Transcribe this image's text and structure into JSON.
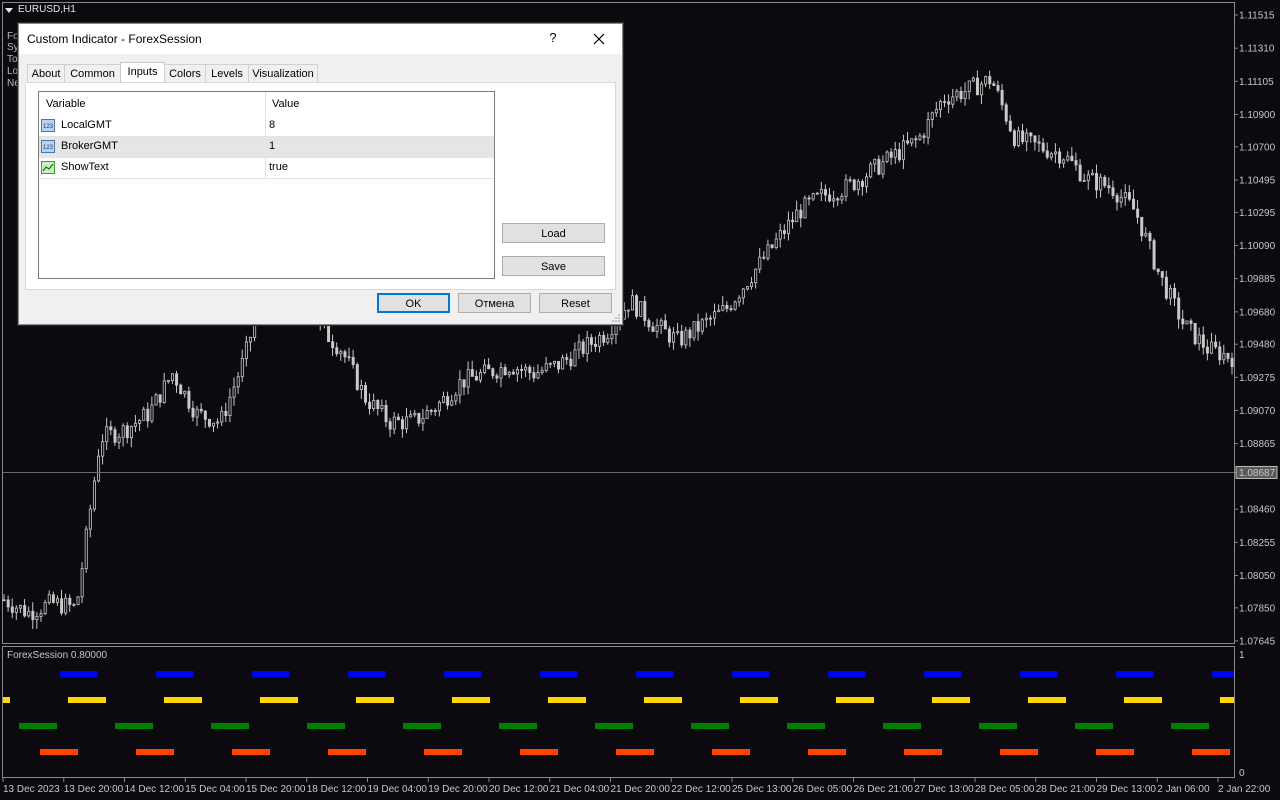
{
  "window": {
    "symbol_title": "EURUSD,H1"
  },
  "left_stubs": [
    "Fo",
    "Sy",
    "To",
    "Lo",
    "Ne"
  ],
  "price_axis": {
    "labels": [
      "1.11515",
      "1.11310",
      "1.11105",
      "1.10900",
      "1.10700",
      "1.10495",
      "1.10295",
      "1.10090",
      "1.09885",
      "1.09680",
      "1.09480",
      "1.09275",
      "1.09070",
      "1.08865",
      "1.08687",
      "1.08460",
      "1.08255",
      "1.08050",
      "1.07850",
      "1.07645"
    ],
    "current_price": "1.08687"
  },
  "time_axis": {
    "labels": [
      "13 Dec 2023",
      "13 Dec 20:00",
      "14 Dec 12:00",
      "15 Dec 04:00",
      "15 Dec 20:00",
      "18 Dec 12:00",
      "19 Dec 04:00",
      "19 Dec 20:00",
      "20 Dec 12:00",
      "21 Dec 04:00",
      "21 Dec 20:00",
      "22 Dec 12:00",
      "25 Dec 13:00",
      "26 Dec 05:00",
      "26 Dec 21:00",
      "27 Dec 13:00",
      "28 Dec 05:00",
      "28 Dec 21:00",
      "29 Dec 13:00",
      "2 Jan 06:00",
      "2 Jan 22:00"
    ]
  },
  "subwindow": {
    "title": "ForexSession 0.80000",
    "scale_top": "1",
    "scale_bottom": "0",
    "session_colors": [
      "#0000ff",
      "#ffd700",
      "#008000",
      "#ff4500"
    ]
  },
  "chart_data": {
    "type": "candlestick",
    "approx_close_path": [
      1.079,
      1.0782,
      1.0788,
      1.0785,
      1.089,
      1.0895,
      1.0905,
      1.093,
      1.0905,
      1.09,
      1.094,
      1.0995,
      1.101,
      1.096,
      1.0945,
      1.0915,
      1.09,
      1.09,
      1.091,
      1.0925,
      1.093,
      1.0935,
      1.093,
      1.0935,
      1.0945,
      1.0955,
      1.0975,
      1.096,
      1.095,
      1.096,
      1.097,
      1.099,
      1.101,
      1.103,
      1.104,
      1.1045,
      1.1055,
      1.1065,
      1.1075,
      1.11,
      1.1105,
      1.1112,
      1.1075,
      1.107,
      1.1065,
      1.105,
      1.1045,
      1.103,
      1.099,
      1.096,
      1.0945,
      1.094
    ]
  },
  "dialog": {
    "title": "Custom Indicator - ForexSession",
    "help_label": "?",
    "tabs": [
      "About",
      "Common",
      "Inputs",
      "Colors",
      "Levels",
      "Visualization"
    ],
    "active_tab": "Inputs",
    "grid": {
      "headers": [
        "Variable",
        "Value"
      ],
      "rows": [
        {
          "name": "LocalGMT",
          "value": "8",
          "icon": "int-param-icon"
        },
        {
          "name": "BrokerGMT",
          "value": "1",
          "icon": "int-param-icon"
        },
        {
          "name": "ShowText",
          "value": "true",
          "icon": "bool-param-icon"
        }
      ]
    },
    "load_label": "Load",
    "save_label": "Save",
    "ok_label": "OK",
    "cancel_label": "Отмена",
    "reset_label": "Reset"
  }
}
